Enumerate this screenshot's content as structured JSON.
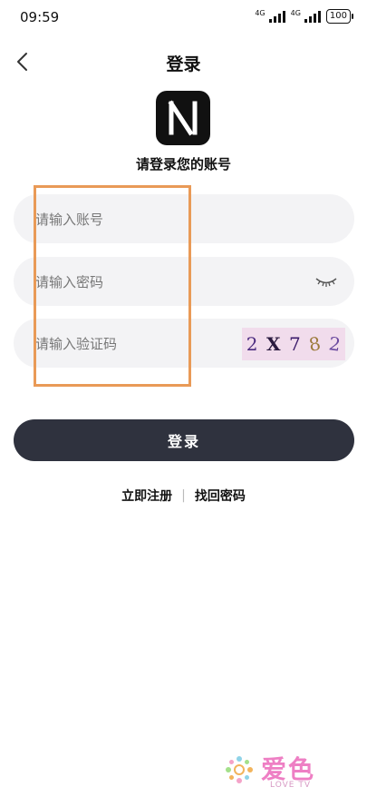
{
  "status": {
    "time": "09:59",
    "signal1_label": "4G",
    "signal2_label": "4G",
    "battery": "100"
  },
  "header": {
    "title": "登录"
  },
  "logo": {
    "letter": "N"
  },
  "subtitle": "请登录您的账号",
  "form": {
    "account_placeholder": "请输入账号",
    "password_placeholder": "请输入密码",
    "captcha_placeholder": "请输入验证码",
    "captcha_chars": [
      "2",
      "X",
      "7",
      "8",
      "2"
    ]
  },
  "login_button": "登录",
  "links": {
    "register": "立即注册",
    "separator": "|",
    "forgot": "找回密码"
  },
  "watermark": {
    "title": "爱色",
    "subtitle": "LOVE TV"
  },
  "colors": {
    "button": "#2f323e",
    "field_bg": "#f3f3f5",
    "annotation": "#e99a57",
    "watermark": "#ee7fc4"
  }
}
